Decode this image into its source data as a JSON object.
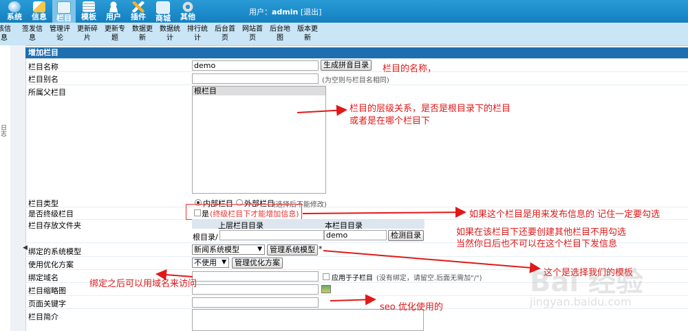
{
  "topnav": [
    {
      "label": "系统",
      "icon": "globe-icon",
      "color": "#e8f4ff"
    },
    {
      "label": "信息",
      "icon": "pencil-icon",
      "color": "#f6d06a"
    },
    {
      "label": "栏目",
      "icon": "folder-icon",
      "color": "#9fd0f0"
    },
    {
      "label": "模板",
      "icon": "template-icon",
      "color": "#bfe0f5"
    },
    {
      "label": "用户",
      "icon": "user-icon",
      "color": "#e9f3fb"
    },
    {
      "label": "插件",
      "icon": "plugin-icon",
      "color": "#f0c040"
    },
    {
      "label": "商城",
      "icon": "shop-icon",
      "color": "#d5ecfa"
    },
    {
      "label": "其他",
      "icon": "gear-icon",
      "color": "#e4e4e4"
    }
  ],
  "user": {
    "prefix": "用户：",
    "name": "admin",
    "logout": "[退出]"
  },
  "subnav": [
    {
      "l1": "核信",
      "l2": "息"
    },
    {
      "l1": "签发信",
      "l2": "息"
    },
    {
      "l1": "管理评",
      "l2": "论"
    },
    {
      "l1": "更新碎",
      "l2": "片"
    },
    {
      "l1": "更新专",
      "l2": "题"
    },
    {
      "l1": "数据更",
      "l2": "新"
    },
    {
      "l1": "数据统",
      "l2": "计"
    },
    {
      "l1": "排行统",
      "l2": "计"
    },
    {
      "l1": "后台首",
      "l2": "页"
    },
    {
      "l1": "网站首",
      "l2": "页"
    },
    {
      "l1": "后台地",
      "l2": "图"
    },
    {
      "l1": "版本更",
      "l2": "新"
    }
  ],
  "leftpanel": {
    "rotated_text": "日志",
    "toggle": "◀"
  },
  "form": {
    "header": "增加栏目",
    "name": {
      "label": "栏目名称",
      "value": "demo",
      "button": "生成拼音目录"
    },
    "alias": {
      "label": "栏目别名",
      "value": "",
      "hint": "(为空则与栏目名相同)"
    },
    "parent": {
      "label": "所属父栏目",
      "option": "根栏目"
    },
    "type": {
      "label": "栏目类型",
      "opt1": "内部栏目",
      "opt2": "外部栏目",
      "hint": "(选择后不能修改)"
    },
    "terminal": {
      "label": "是否终级栏目",
      "check_label": "是",
      "warn": "(终级栏目下才能增加信息)"
    },
    "folder": {
      "label": "栏目存放文件夹",
      "col1": "上层栏目目录",
      "col2": "本栏目目录",
      "root": "根目录/",
      "value": "demo",
      "button": "检测目录"
    },
    "model": {
      "label": "绑定的系统模型",
      "value": "新闻系统模型",
      "button": "管理系统模型",
      "star": "*"
    },
    "optimize": {
      "label": "使用优化方案",
      "value": "不使用",
      "button": "管理优化方案"
    },
    "domain": {
      "label": "绑定域名",
      "check_label": "应用于子栏目",
      "hint": "(没有绑定，请留空.后面无需加\"/\")"
    },
    "thumb": {
      "label": "栏目缩略图"
    },
    "keywords": {
      "label": "页面关键字"
    },
    "intro": {
      "label": "栏目简介"
    }
  },
  "annotations": {
    "a1": "栏目的名称，",
    "a2a": "栏目的层级关系，是否是根目录下的栏目",
    "a2b": "或者是在哪个栏目下",
    "a3": "如果这个栏目是用来发布信息的 记住一定要勾选",
    "a4a": "如果在该栏目下还要创建其他栏目不用勾选",
    "a4b": "当然你日后也不可以在这个栏目下发信息",
    "a5": "这个是选择我们的模板",
    "a6": "绑定之后可以用域名来访问",
    "a7": "seo 优化使用的"
  },
  "watermark": {
    "main": "Bai 经验",
    "sub": "jingyan.baidu.com"
  },
  "colors": {
    "nav": "#1f87c9",
    "header": "#1f6eaf",
    "annotation": "#e01818"
  }
}
